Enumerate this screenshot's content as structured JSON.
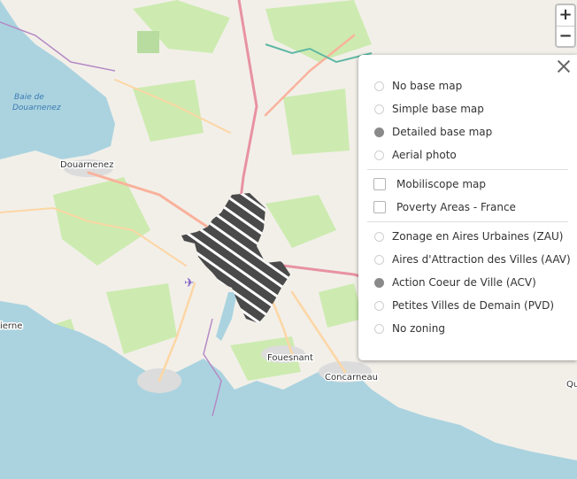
{
  "map": {
    "places": [
      {
        "id": "douarnenez",
        "label": "Douarnenez"
      },
      {
        "id": "fouesnant",
        "label": "Fouesnant"
      },
      {
        "id": "concarneau",
        "label": "Concarneau"
      },
      {
        "id": "qu",
        "label": "Qu"
      },
      {
        "id": "ierne",
        "label": "ierne"
      }
    ],
    "bay_label_line1": "Baie de",
    "bay_label_line2": "Douarnenez",
    "colors": {
      "land": "#f2efe9",
      "sea": "#aad3df",
      "green": "#cdebb0",
      "urban": "#dcdcdc",
      "hatch": "#4a4a4a"
    }
  },
  "zoom": {
    "in_label": "+",
    "out_label": "−"
  },
  "panel": {
    "base_maps": [
      {
        "label": "No base map",
        "selected": false
      },
      {
        "label": "Simple base map",
        "selected": false
      },
      {
        "label": "Detailed base map",
        "selected": true
      },
      {
        "label": "Aerial photo",
        "selected": false
      }
    ],
    "overlays": [
      {
        "label": "Mobiliscope map",
        "checked": false
      },
      {
        "label": "Poverty Areas - France",
        "checked": false
      }
    ],
    "zonings": [
      {
        "label": "Zonage en Aires Urbaines (ZAU)",
        "selected": false
      },
      {
        "label": "Aires d'Attraction des Villes (AAV)",
        "selected": false
      },
      {
        "label": "Action Coeur de Ville (ACV)",
        "selected": true
      },
      {
        "label": "Petites Villes de Demain (PVD)",
        "selected": false
      },
      {
        "label": "No zoning",
        "selected": false
      }
    ]
  }
}
